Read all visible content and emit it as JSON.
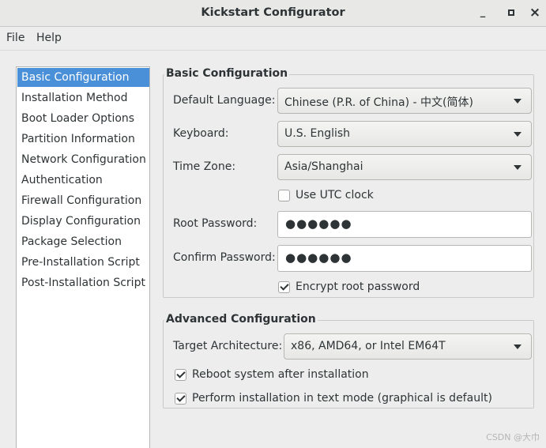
{
  "window": {
    "title": "Kickstart Configurator",
    "minimize": "_",
    "maximize": "□",
    "close": "×"
  },
  "menubar": {
    "file": "File",
    "help": "Help"
  },
  "sidebar": {
    "items": [
      "Basic Configuration",
      "Installation Method",
      "Boot Loader Options",
      "Partition Information",
      "Network Configuration",
      "Authentication",
      "Firewall Configuration",
      "Display Configuration",
      "Package Selection",
      "Pre-Installation Script",
      "Post-Installation Script"
    ],
    "selected": "Basic Configuration"
  },
  "basic": {
    "heading": "Basic Configuration",
    "default_language_label": "Default Language:",
    "default_language_value": "Chinese (P.R. of China) - 中文(简体)",
    "keyboard_label": "Keyboard:",
    "keyboard_value": "U.S. English",
    "timezone_label": "Time Zone:",
    "timezone_value": "Asia/Shanghai",
    "utc_label": "Use UTC clock",
    "utc_checked": false,
    "root_password_label": "Root Password:",
    "root_password_value": "●●●●●●",
    "confirm_password_label": "Confirm Password:",
    "confirm_password_value": "●●●●●●",
    "encrypt_label": "Encrypt root password",
    "encrypt_checked": true
  },
  "advanced": {
    "heading": "Advanced Configuration",
    "arch_label": "Target Architecture:",
    "arch_value": "x86, AMD64, or Intel EM64T",
    "reboot_label": "Reboot system after installation",
    "reboot_checked": true,
    "textmode_label": "Perform installation in text mode (graphical is default)",
    "textmode_checked": true
  },
  "watermark": "CSDN @大巾"
}
